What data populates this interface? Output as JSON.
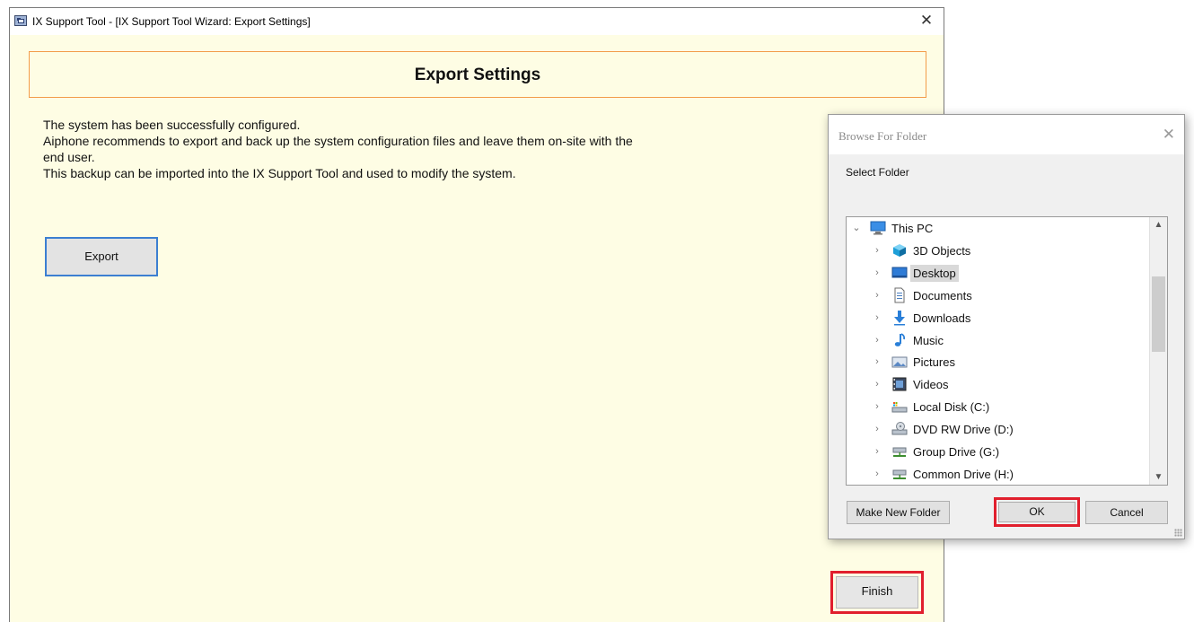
{
  "main_window": {
    "title": "IX Support Tool - [IX Support Tool Wizard: Export Settings]",
    "close_glyph": "✕",
    "header": "Export Settings",
    "intro_lines": [
      "The system has been successfully configured.",
      "Aiphone recommends to export and back up the system configuration files and leave them on-site with the",
      "end user.",
      "This backup can be imported into the IX Support Tool and used to modify the system."
    ],
    "export_label": "Export",
    "finish_label": "Finish"
  },
  "dialog": {
    "title": "Browse For Folder",
    "close_glyph": "✕",
    "select_label": "Select Folder",
    "tree": [
      {
        "label": "This PC",
        "icon": "computer-icon",
        "expander": "⌄"
      },
      {
        "label": "3D Objects",
        "icon": "3d-objects-icon",
        "expander": "›"
      },
      {
        "label": "Desktop",
        "icon": "desktop-icon",
        "expander": "›",
        "selected": true
      },
      {
        "label": "Documents",
        "icon": "documents-icon",
        "expander": "›"
      },
      {
        "label": "Downloads",
        "icon": "downloads-icon",
        "expander": "›"
      },
      {
        "label": "Music",
        "icon": "music-icon",
        "expander": "›"
      },
      {
        "label": "Pictures",
        "icon": "pictures-icon",
        "expander": "›"
      },
      {
        "label": "Videos",
        "icon": "videos-icon",
        "expander": "›"
      },
      {
        "label": "Local Disk (C:)",
        "icon": "local-disk-icon",
        "expander": "›"
      },
      {
        "label": "DVD RW Drive (D:)",
        "icon": "dvd-drive-icon",
        "expander": "›"
      },
      {
        "label": "Group Drive (G:)",
        "icon": "network-drive-icon",
        "expander": "›"
      },
      {
        "label": "Common Drive (H:)",
        "icon": "network-drive-icon",
        "expander": "›"
      }
    ],
    "make_new_folder_label": "Make New Folder",
    "ok_label": "OK",
    "cancel_label": "Cancel"
  },
  "colors": {
    "window_bg": "#fefde4",
    "header_border": "#f39c4a",
    "highlight_red": "#e11f2d",
    "focus_blue": "#3c7fd1"
  }
}
